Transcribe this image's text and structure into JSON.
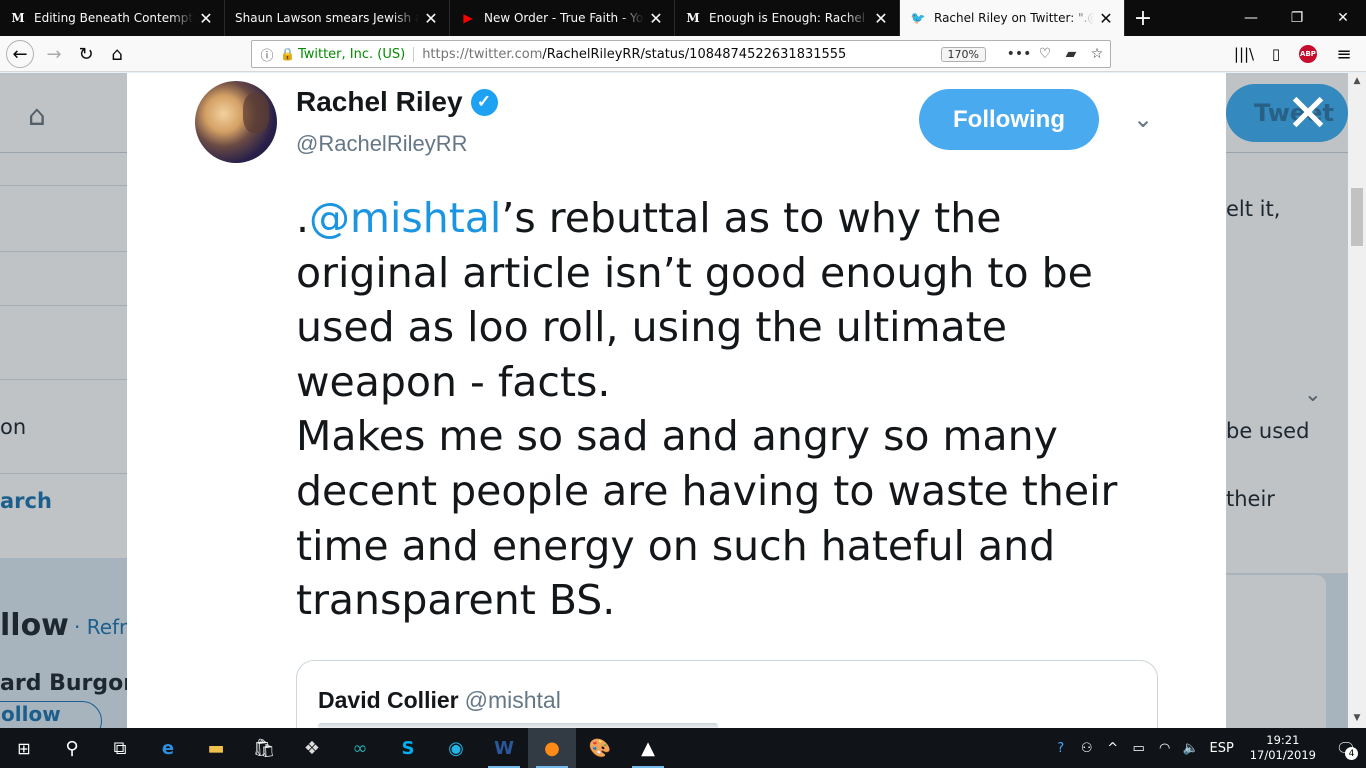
{
  "browser": {
    "tabs": [
      {
        "favicon": "M",
        "favicon_color": "#ffffff",
        "title": "Editing Beneath Contempt: How"
      },
      {
        "favicon": "",
        "favicon_color": "#ffffff",
        "title": "Shaun Lawson smears Jewish anti-r"
      },
      {
        "favicon": "▶",
        "favicon_color": "#ff0000",
        "title": "New Order - True Faith - YouTu"
      },
      {
        "favicon": "M",
        "favicon_color": "#ffffff",
        "title": "Enough is Enough: Rachel Riley"
      },
      {
        "favicon": "🐦",
        "favicon_color": "#1da1f2",
        "title": "Rachel Riley on Twitter: \".@mist"
      }
    ],
    "address": {
      "org": "Twitter, Inc. (US)",
      "url_host": "https://twitter.com",
      "url_path": "/RachelRileyRR/status/1084874522631831555",
      "zoom": "170%"
    }
  },
  "background": {
    "tweet_button": "Tweet",
    "left_fragments": [
      "on",
      "arch",
      "llow",
      "· Refres",
      "ard Burgon",
      "ollow"
    ],
    "right_fragments": [
      "elt it,",
      "be used",
      "their"
    ]
  },
  "tweet": {
    "author_name": "Rachel Riley",
    "author_handle": "@RachelRileyRR",
    "follow_label": "Following",
    "lines": [
      {
        "pre": ".",
        "mention": "@mishtal",
        "post": "’s rebuttal as to why the"
      },
      {
        "pre": "original article isn’t good enough to be"
      },
      {
        "pre": "used as loo roll, using the ultimate"
      },
      {
        "pre": "weapon - facts."
      },
      {
        "pre": "Makes me so sad and angry so many"
      },
      {
        "pre": "decent people are having to waste their"
      },
      {
        "pre": "time and energy on such hateful and"
      },
      {
        "pre": "transparent BS."
      }
    ],
    "quoted": {
      "name": "David Collier",
      "handle": "@mishtal"
    }
  },
  "taskbar": {
    "language": "ESP",
    "time": "19:21",
    "date": "17/01/2019",
    "notifications": "4"
  }
}
